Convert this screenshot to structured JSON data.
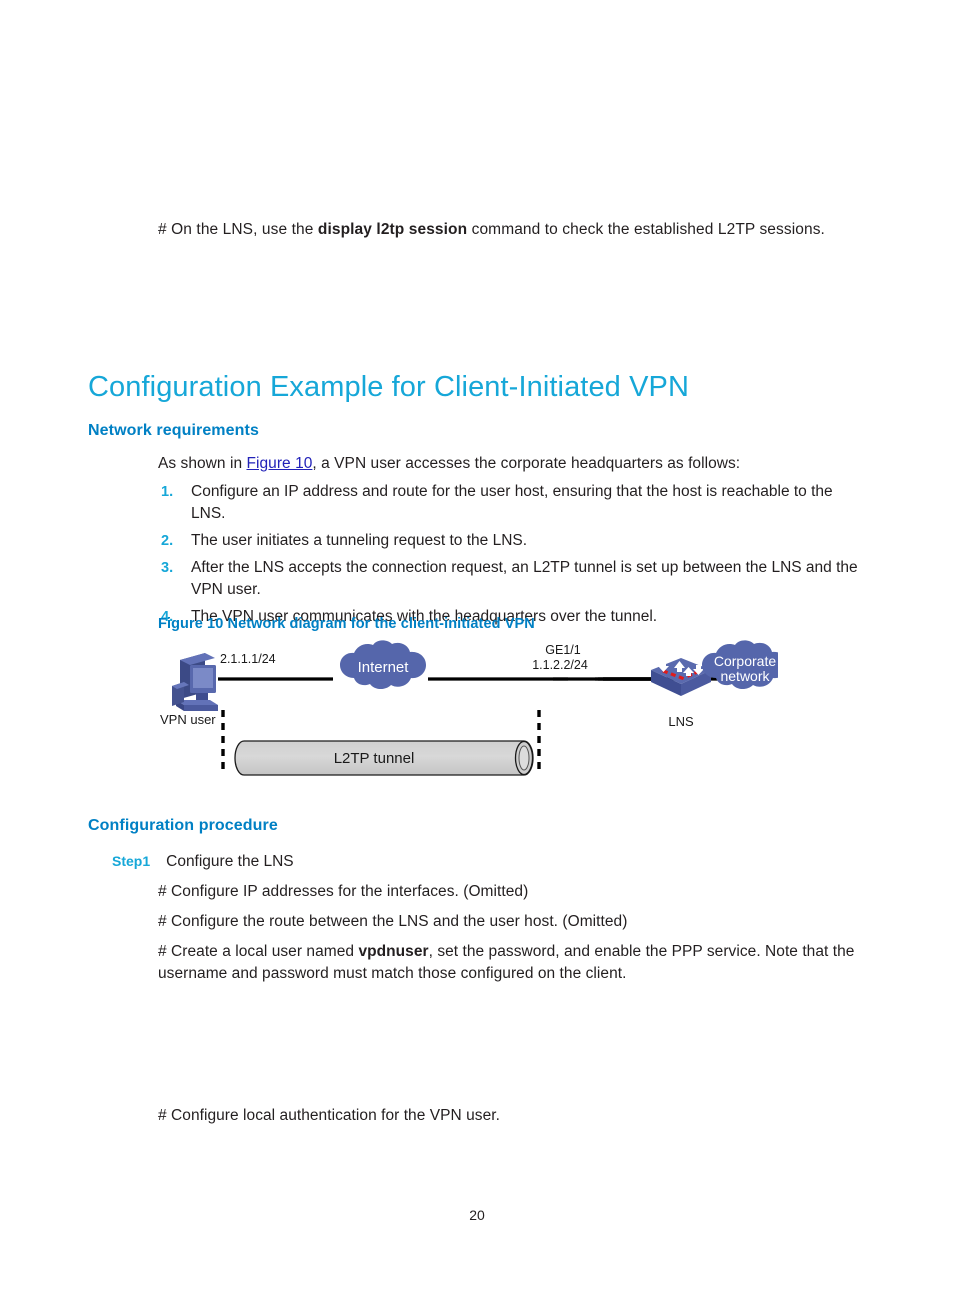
{
  "intro": {
    "before": "# On the LNS, use the ",
    "command": "display l2tp session",
    "after": " command to check the established L2TP sessions."
  },
  "heading": {
    "title": "Configuration Example for Client-Initiated VPN",
    "network_requirements": "Network requirements",
    "configuration_procedure": "Configuration procedure"
  },
  "requirements": {
    "lead_before": "As shown in ",
    "lead_link": "Figure 10",
    "lead_after": ", a VPN user accesses the corporate headquarters as follows:",
    "items": [
      {
        "num": "1.",
        "text": "Configure an IP address and route for the user host, ensuring that the host is reachable to the LNS."
      },
      {
        "num": "2.",
        "text": "The user initiates a tunneling request to the LNS."
      },
      {
        "num": "3.",
        "text": "After the LNS accepts the connection request, an L2TP tunnel is set up between the LNS and the VPN user."
      },
      {
        "num": "4.",
        "text": "The VPN user communicates with the headquarters over the tunnel."
      }
    ]
  },
  "figure": {
    "caption": "Figure 10 Network diagram for the client-initiated VPN",
    "labels": {
      "host_ip": "2.1.1.1/24",
      "vpn_user": "VPN user",
      "internet": "Internet",
      "interface": "GE1/1",
      "interface_ip": "1.1.2.2/24",
      "lns": "LNS",
      "corporate_line1": "Corporate",
      "corporate_line2": "network",
      "tunnel": "L2TP tunnel"
    },
    "colors": {
      "cloud_fill": "#5566ab",
      "device_blue": "#4a5aa0",
      "tunnel_fill": "#d4d4d4",
      "link_line": "#000000"
    }
  },
  "procedure": {
    "step_label": "Step1",
    "step_text": "Configure the LNS",
    "cmd1": "# Configure IP addresses for the interfaces. (Omitted)",
    "cmd2": "# Configure the route between the LNS and the user host. (Omitted)",
    "cmd3_before": "# Create a local user named ",
    "cmd3_bold": "vpdnuser",
    "cmd3_after": ", set the password, and enable the PPP service. Note that the username and password must match those configured on the client.",
    "cmd4": "# Configure local authentication for the VPN user."
  },
  "footer": {
    "page_number": "20"
  }
}
